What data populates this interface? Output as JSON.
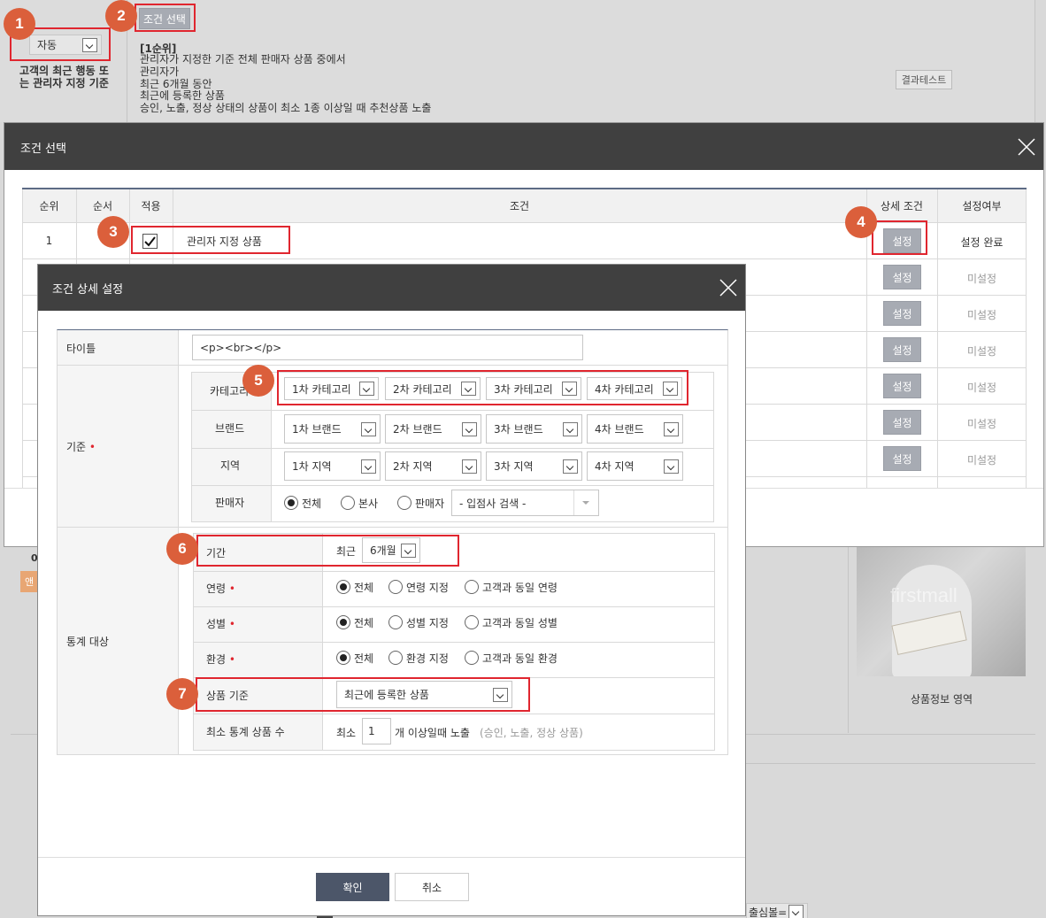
{
  "background": {
    "mode_select": "자동",
    "description_label": "고객의 최근 행동 또는 관리자 지정 기준",
    "condition_button": "조건 선택",
    "rank_title": "[1순위]",
    "rank_lines": [
      "관리자가 지정한 기준 전체 판매자 상품 중에서",
      "관리자가",
      "최근 6개월 동안",
      "최근에 등록한 상품",
      "승인, 노출, 정상 상태의 상품이 최소 1종 이상일 때 추천상품 노출"
    ],
    "result_test_button": "결과테스트",
    "product_info_area": "상품정보 영역",
    "image_watermark": "firstmall",
    "partial_left_text": "0",
    "partial_left_button": "앤",
    "partial_bottom_select": "출심볼="
  },
  "condition_modal": {
    "title": "조건 선택",
    "columns": [
      "순위",
      "순서",
      "적용",
      "조건",
      "상세 조건",
      "설정여부"
    ],
    "row1": {
      "rank": "1",
      "applied": true,
      "condition": "관리자 지정 상품",
      "detail_button": "설정",
      "status": "설정 완료"
    },
    "other_rows": [
      {
        "detail_button": "설정",
        "status": "미설정"
      },
      {
        "detail_button": "설정",
        "status": "미설정"
      },
      {
        "detail_button": "설정",
        "status": "미설정"
      },
      {
        "detail_button": "설정",
        "status": "미설정"
      },
      {
        "detail_button": "설정",
        "status": "미설정"
      },
      {
        "detail_button": "설정",
        "status": "미설정"
      }
    ]
  },
  "detail_modal": {
    "title": "조건 상세 설정",
    "title_label": "타이틀",
    "title_value": "<p><br></p>",
    "criteria_label": "기준",
    "category_label": "카테고리",
    "categories": [
      "1차 카테고리",
      "2차 카테고리",
      "3차 카테고리",
      "4차 카테고리"
    ],
    "brand_label": "브랜드",
    "brands": [
      "1차 브랜드",
      "2차 브랜드",
      "3차 브랜드",
      "4차 브랜드"
    ],
    "region_label": "지역",
    "regions": [
      "1차 지역",
      "2차 지역",
      "3차 지역",
      "4차 지역"
    ],
    "seller_label": "판매자",
    "seller_options": [
      "전체",
      "본사",
      "판매자"
    ],
    "seller_search": "- 입점사 검색 -",
    "stats_label": "통계 대상",
    "period_label": "기간",
    "period_prefix": "최근",
    "period_value": "6개월",
    "age_label": "연령",
    "age_options": [
      "전체",
      "연령 지정",
      "고객과 동일 연령"
    ],
    "gender_label": "성별",
    "gender_options": [
      "전체",
      "성별 지정",
      "고객과 동일 성별"
    ],
    "env_label": "환경",
    "env_options": [
      "전체",
      "환경 지정",
      "고객과 동일 환경"
    ],
    "product_basis_label": "상품 기준",
    "product_basis_value": "최근에 등록한 상품",
    "min_count_label": "최소 통계 상품 수",
    "min_prefix": "최소",
    "min_value": "1",
    "min_suffix": "개 이상일때 노출",
    "min_note": "(승인, 노출, 정상 상품)",
    "confirm_button": "확인",
    "cancel_button": "취소"
  },
  "badges": [
    "1",
    "2",
    "3",
    "4",
    "5",
    "6",
    "7"
  ],
  "colors": {
    "badge": "#db5f3b",
    "highlight": "#e0262f",
    "header": "#404040",
    "confirm": "#4c5669",
    "button_gray": "#a7abb3"
  }
}
